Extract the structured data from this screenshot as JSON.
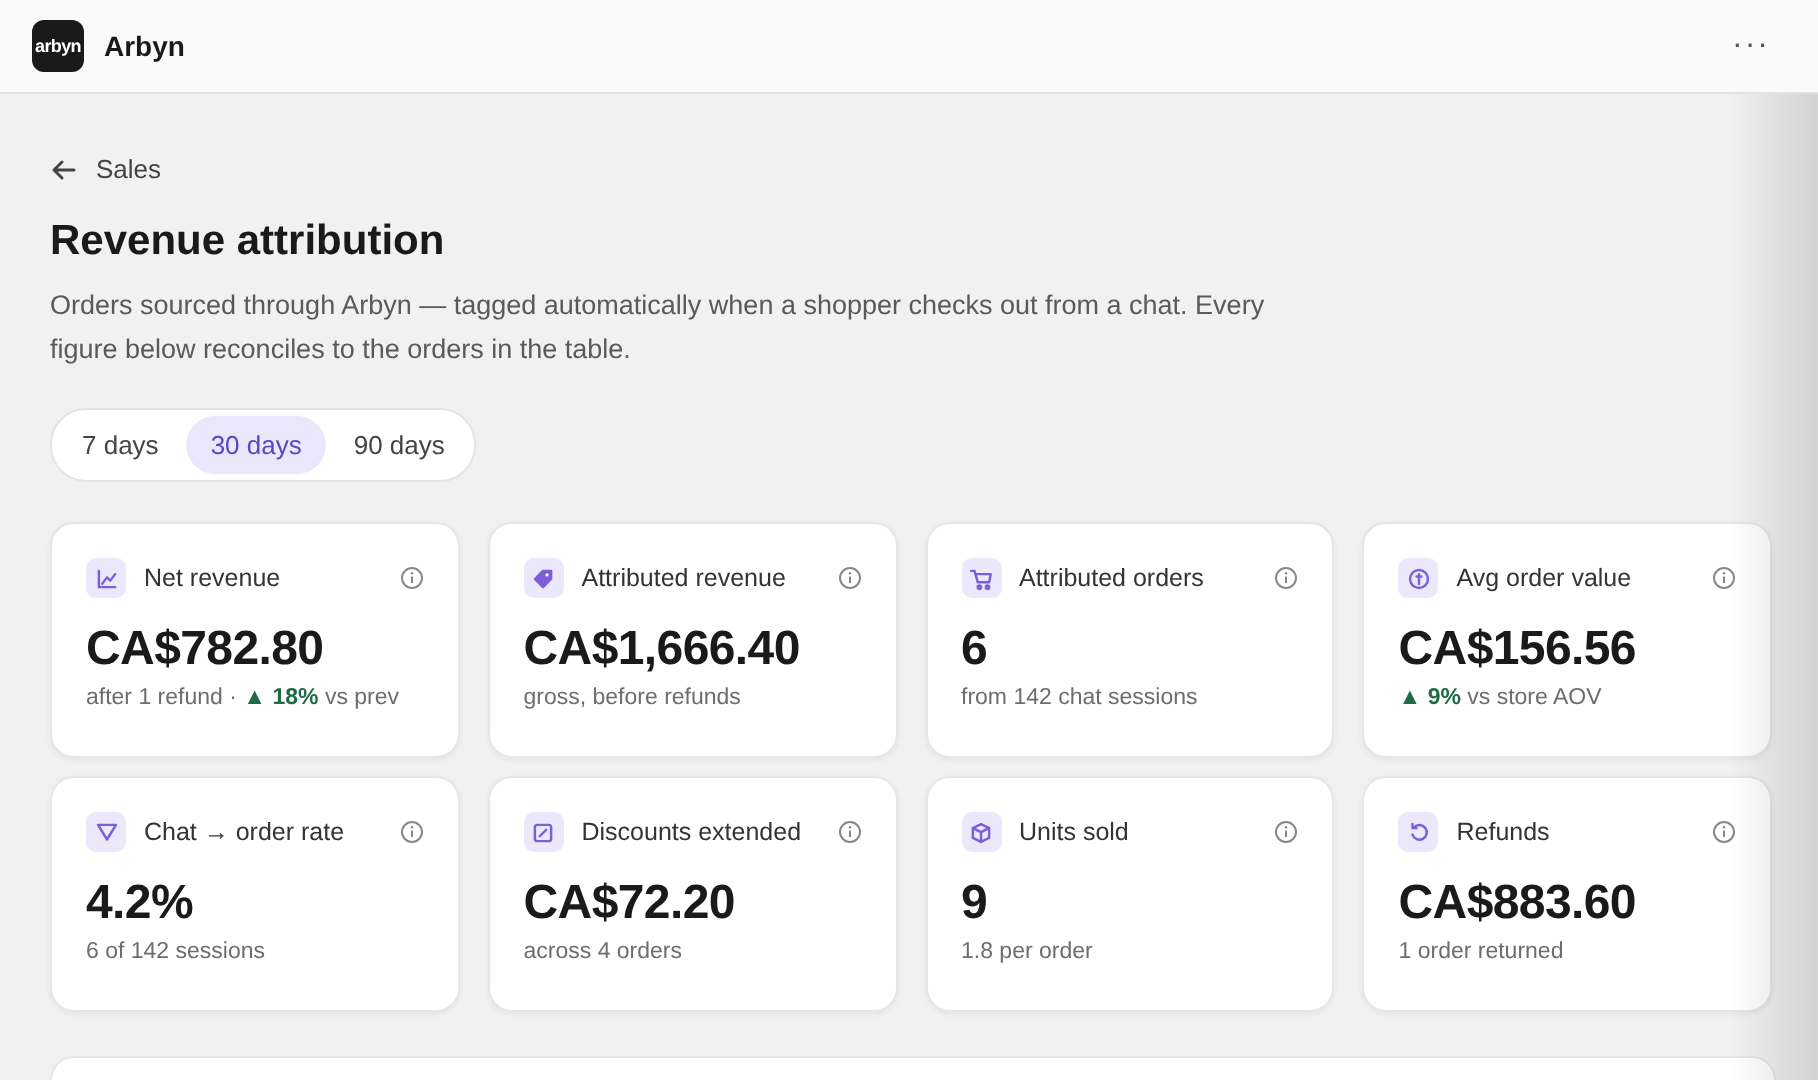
{
  "app": {
    "logo": "arbyn",
    "name": "Arbyn",
    "menu": "···"
  },
  "back": {
    "label": "Sales"
  },
  "title": "Revenue attribution",
  "description": "Orders sourced through Arbyn — tagged automatically when a shopper checks out from a chat. Every figure below reconciles to the orders in the table.",
  "ranges": [
    {
      "label": "7 days",
      "selected": false
    },
    {
      "label": "30 days",
      "selected": true
    },
    {
      "label": "90 days",
      "selected": false
    }
  ],
  "cards": [
    {
      "kind": "chart",
      "label": "Net revenue",
      "value": "CA$782.80",
      "note": "after 1 refund ·",
      "change": {
        "arrow": "▲",
        "value": "18%"
      },
      "suffix": "vs prev"
    },
    {
      "kind": "tag",
      "label": "Attributed revenue",
      "value": "CA$1,666.40",
      "note": "gross, before refunds"
    },
    {
      "kind": "cart",
      "label": "Attributed orders",
      "value": "6",
      "note": "from 142 chat sessions"
    },
    {
      "kind": "coin",
      "label": "Avg order value",
      "value": "CA$156.56",
      "change": {
        "arrow": "▲",
        "value": "9%"
      },
      "suffix": "vs store AOV"
    },
    {
      "kind": "funnel",
      "label": "Chat → order rate",
      "value": "4.2%",
      "note": "6 of 142 sessions"
    },
    {
      "kind": "discount",
      "label": "Discounts extended",
      "value": "CA$72.20",
      "note": "across 4 orders"
    },
    {
      "kind": "box",
      "label": "Units sold",
      "value": "9",
      "note": "1.8 per order"
    },
    {
      "kind": "refund",
      "label": "Refunds",
      "value": "CA$883.60",
      "note": "1 order returned"
    }
  ]
}
